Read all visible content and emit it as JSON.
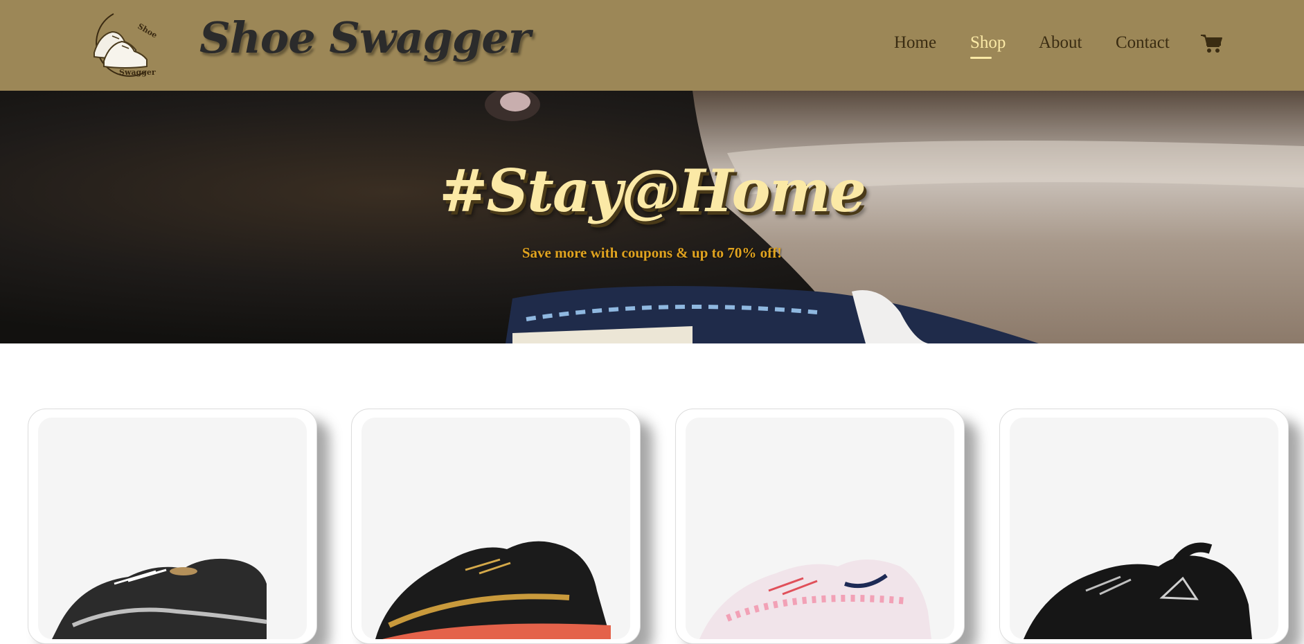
{
  "header": {
    "brand_name": "Shoe Swagger",
    "logo_text_top": "Shoe",
    "logo_text_bottom": "Swagger",
    "nav": [
      {
        "label": "Home",
        "active": false
      },
      {
        "label": "Shop",
        "active": true
      },
      {
        "label": "About",
        "active": false
      },
      {
        "label": "Contact",
        "active": false
      }
    ],
    "cart_icon": "shopping-cart-icon"
  },
  "hero": {
    "title": "#Stay@Home",
    "subtitle": "Save more with coupons & up to 70% off!"
  },
  "products": [
    {
      "image": "black-silver-running-shoe"
    },
    {
      "image": "black-gold-red-running-shoe"
    },
    {
      "image": "pink-white-floral-running-shoe"
    },
    {
      "image": "black-white-trail-shoe"
    }
  ],
  "colors": {
    "header_bg": "#9c8757",
    "accent": "#fbe9a6",
    "subtitle": "#e0a31f"
  }
}
